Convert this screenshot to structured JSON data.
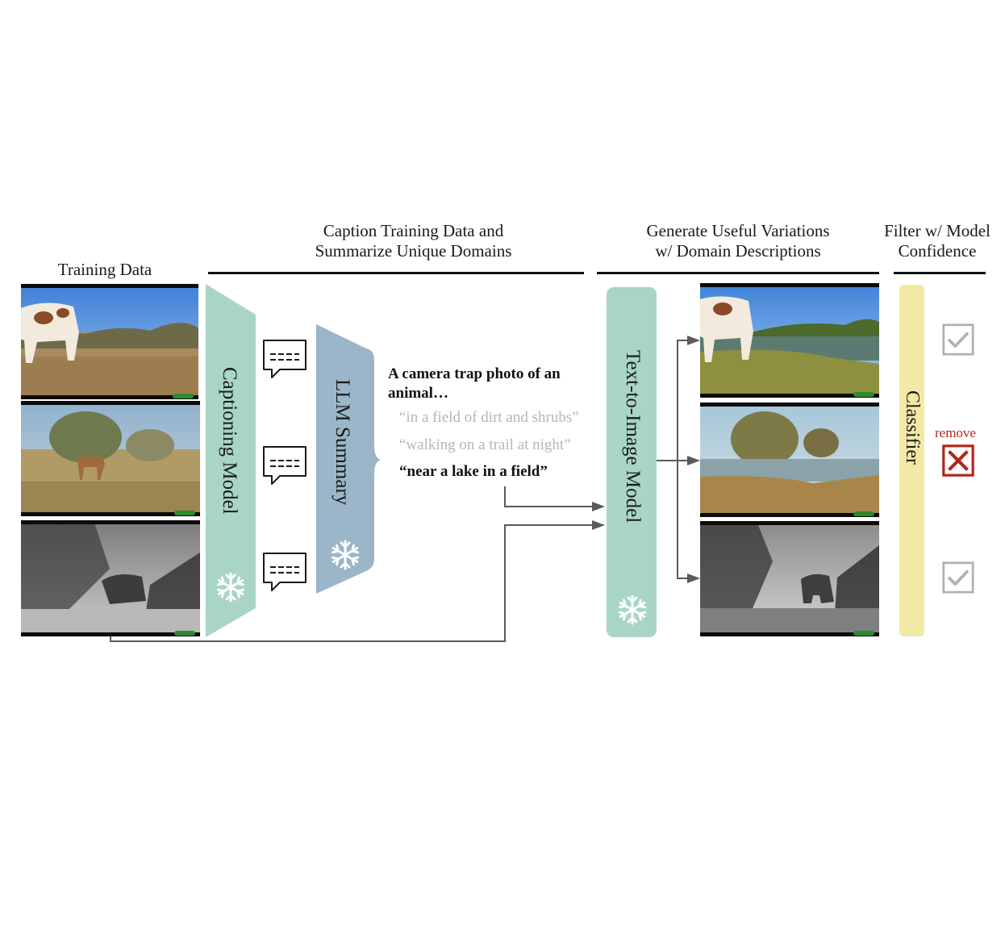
{
  "headers": {
    "training_data": "Training Data",
    "caption_line1": "Caption Training Data and",
    "caption_line2": "Summarize Unique Domains",
    "generate_line1": "Generate Useful Variations",
    "generate_line2": "w/ Domain Descriptions",
    "filter_line1": "Filter w/ Model",
    "filter_line2": "Confidence"
  },
  "models": {
    "captioning": "Captioning Model",
    "llm": "LLM Summary",
    "t2i": "Text-to-Image Model",
    "classifier": "Classifier"
  },
  "colors": {
    "captioning": "#a8d5c6",
    "llm": "#9bb6c8",
    "t2i": "#a8d5c6",
    "classifier": "#f2e9a6",
    "arrow": "#5a5a5a",
    "check": "#b0b0b0",
    "remove": "#b3261e"
  },
  "summary": {
    "title": "A camera trap photo of an animal…",
    "domains": [
      {
        "text": "“in a field of dirt and shrubs”",
        "selected": false
      },
      {
        "text": "“walking on a trail at night”",
        "selected": false
      },
      {
        "text": "“near a lake in a field”",
        "selected": true
      }
    ]
  },
  "training_images": [
    {
      "subject": "cow in dry savanna, daytime"
    },
    {
      "subject": "impala near shrub, daytime"
    },
    {
      "subject": "elephant in brush, night (grayscale)"
    }
  ],
  "generated_images": [
    {
      "subject": "cow near a lake",
      "filter": "keep"
    },
    {
      "subject": "lake with trees, no animal",
      "filter": "remove"
    },
    {
      "subject": "elephant near water, night (grayscale)",
      "filter": "keep"
    }
  ],
  "filter": {
    "remove_label": "remove",
    "icons": [
      "check-icon",
      "x-icon",
      "check-icon"
    ]
  },
  "icons": {
    "frozen": "snowflake-icon",
    "caption": "speech-bubble-icon"
  }
}
